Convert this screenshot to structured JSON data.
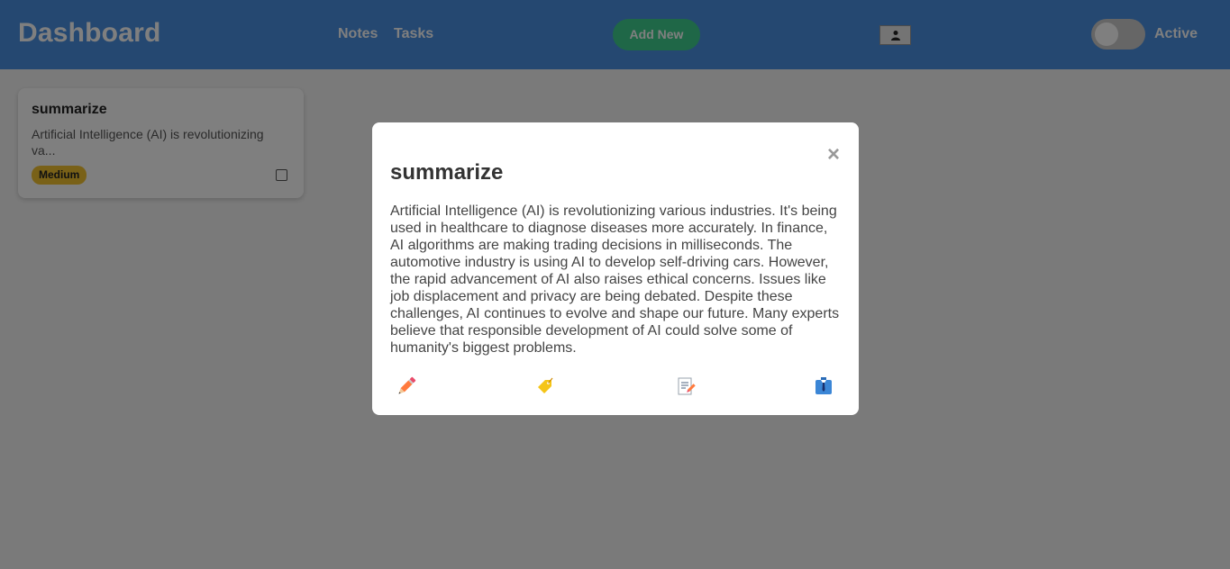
{
  "header": {
    "title": "Dashboard",
    "nav": [
      {
        "label": "Notes"
      },
      {
        "label": "Tasks"
      }
    ],
    "add_button": "Add New",
    "profile_icon": "person-icon",
    "toggle": {
      "label": "Active",
      "on": false
    }
  },
  "notes": [
    {
      "title": "summarize",
      "preview": "Artificial Intelligence (AI) is revolutionizing va...",
      "priority": "Medium",
      "completed": false
    }
  ],
  "modal": {
    "title": "summarize",
    "close_label": "×",
    "body": "Artificial Intelligence (AI) is revolutionizing various industries. It's being used in healthcare to diagnose diseases more accurately. In finance, AI algorithms are making trading decisions in milliseconds. The automotive industry is using AI to develop self-driving cars. However, the rapid advancement of AI also raises ethical concerns. Issues like job displacement and privacy are being debated. Despite these challenges, AI continues to evolve and shape our future. Many experts believe that responsible development of AI could solve some of humanity's biggest problems.",
    "actions": [
      "pencil-icon",
      "tag-icon",
      "memo-icon",
      "suit-icon"
    ]
  },
  "colors": {
    "header": "#4a90e2",
    "add_button": "#3ecf8e",
    "priority_medium": "#f2c230",
    "overlay": "rgba(0,0,0,0.5)"
  }
}
